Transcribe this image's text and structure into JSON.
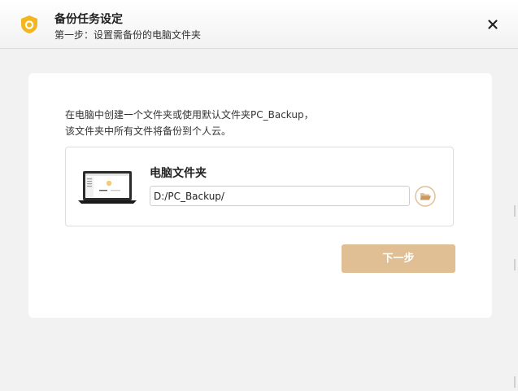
{
  "window": {
    "title": "备份任务设定",
    "subtitle": "第一步：设置需备份的电脑文件夹",
    "close_icon": "close-icon",
    "logo_icon": "shield-logo-icon"
  },
  "main": {
    "description_line1": "在电脑中创建一个文件夹或使用默认文件夹PC_Backup，",
    "description_line2": "该文件夹中所有文件将备份到个人云。",
    "folder_label": "电脑文件夹",
    "folder_path": "D:/PC_Backup/",
    "browse_icon": "folder-open-icon",
    "illustration_icon": "laptop-icon",
    "next_label": "下一步"
  },
  "colors": {
    "accent": "#dfbf93",
    "logo": "#f3b61f",
    "window_bg": "#f2f2f2",
    "card_bg": "#ffffff"
  }
}
